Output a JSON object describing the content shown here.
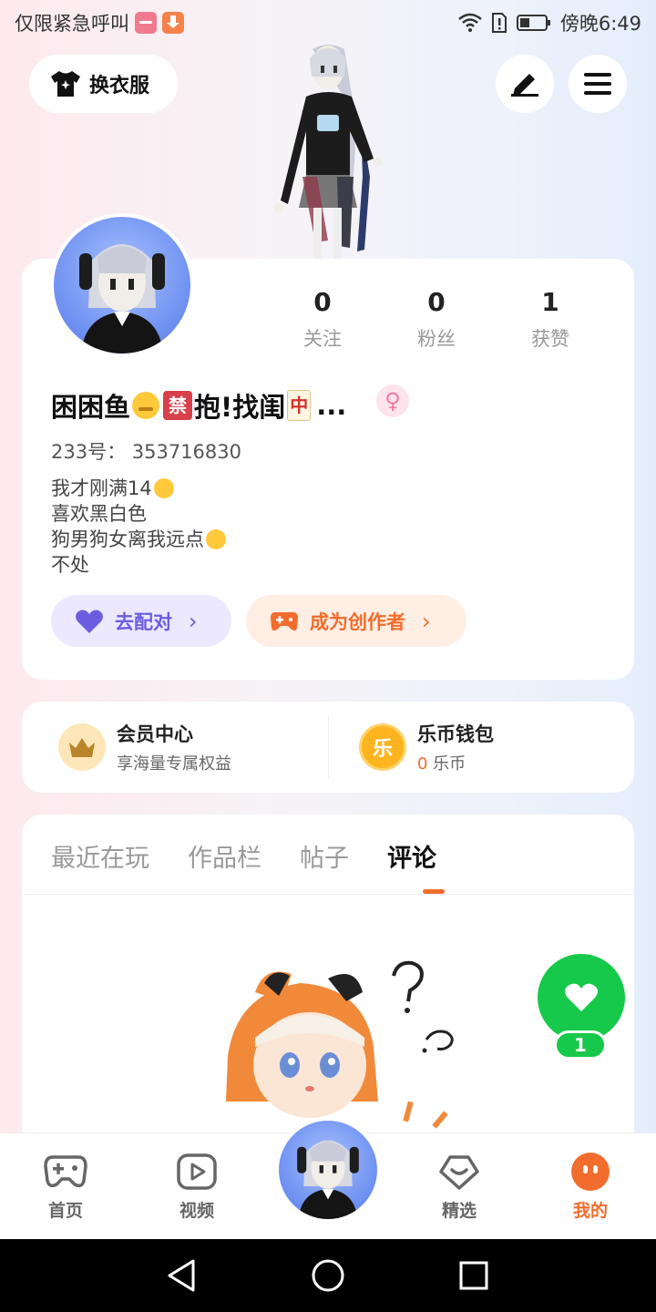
{
  "status_bar": {
    "carrier_text": "仅限紧急呼叫",
    "time": "傍晚6:49",
    "wifi_icon": "wifi-icon",
    "battery_icon": "battery-icon"
  },
  "top_bar": {
    "outfit_label": "换衣服",
    "edit_icon": "pencil-icon",
    "menu_icon": "hamburger-icon"
  },
  "profile": {
    "stats": [
      {
        "value": "0",
        "label": "关注"
      },
      {
        "value": "0",
        "label": "粉丝"
      },
      {
        "value": "1",
        "label": "获赞"
      }
    ],
    "nickname_part1": "困困鱼",
    "nickname_part2": "抱!找闺",
    "nickname_ellipsis": "...",
    "ban_char": "禁",
    "mahjong_char": "中",
    "gender_symbol": "♀",
    "uid": "233号：  353716830",
    "bio": [
      "我才刚满14",
      "喜欢黑白色",
      "狗男狗女离我远点",
      "不处"
    ],
    "match_label": "去配对",
    "creator_label": "成为创作者",
    "chevron": "›"
  },
  "member": {
    "vip_title": "会员中心",
    "vip_sub": "享海量专属权益",
    "wallet_title": "乐币钱包",
    "coin_count": "0",
    "coin_unit": " 乐币",
    "coin_char": "乐"
  },
  "tabs": [
    "最近在玩",
    "作品栏",
    "帖子",
    "评论"
  ],
  "active_tab": "评论",
  "like": {
    "count": "1"
  },
  "bottom_nav": {
    "home": "首页",
    "video": "视频",
    "featured": "精选",
    "mine": "我的"
  },
  "colors": {
    "accent": "#f26d2d",
    "match": "#6c5de0",
    "like": "#16c94a"
  }
}
